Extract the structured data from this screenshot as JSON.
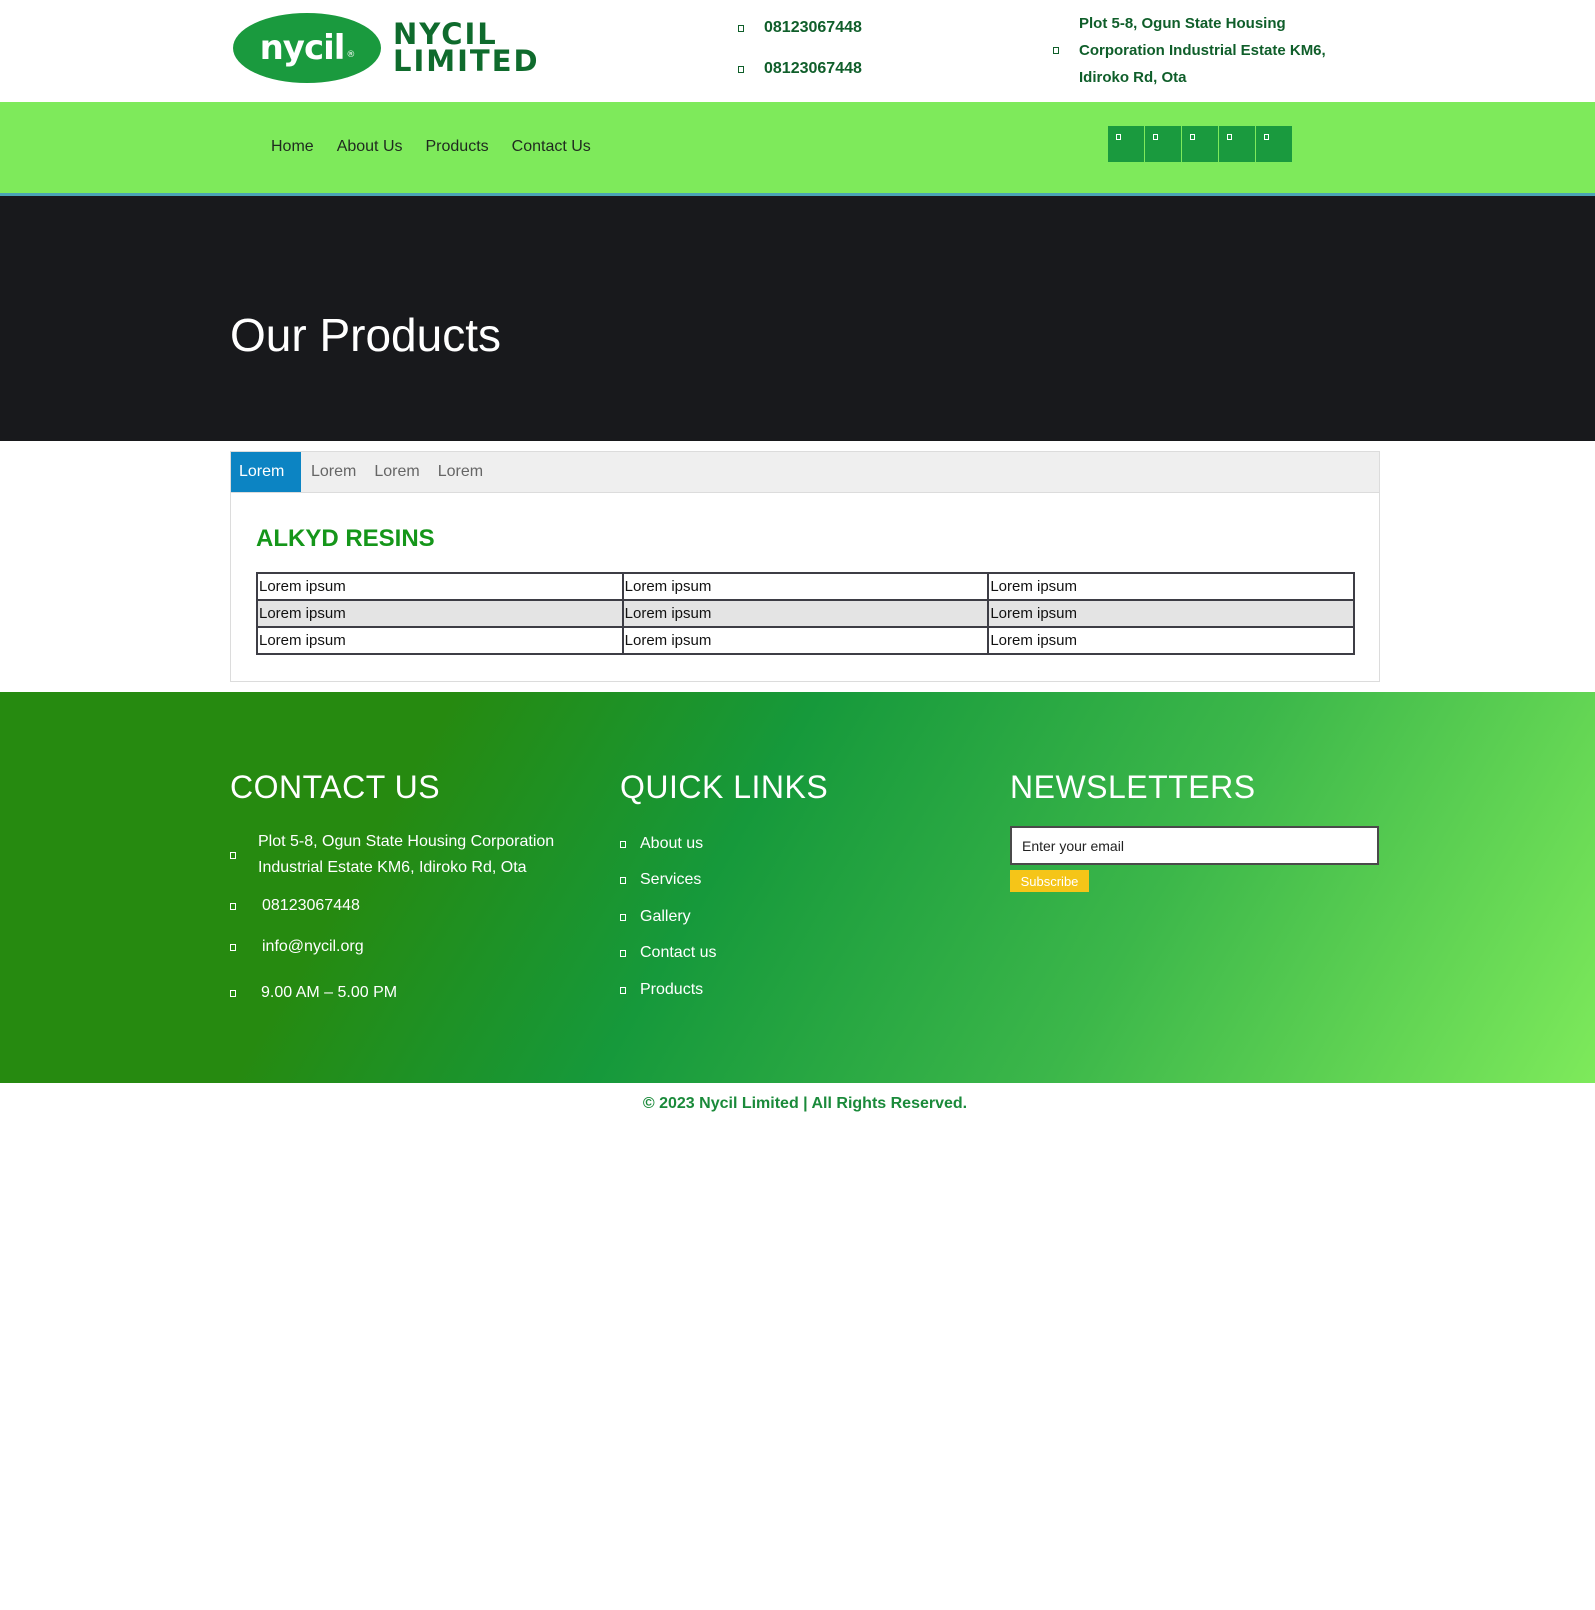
{
  "header": {
    "logo_mark": "nycil",
    "logo_reg": "®",
    "logo_name_line1": "NYCIL",
    "logo_name_line2": "LIMITED",
    "phone_1": "08123067448",
    "phone_2": "08123067448",
    "address": "Plot 5-8, Ogun State Housing Corporation Industrial Estate KM6, Idiroko Rd, Ota",
    "icon_phone": "phone-icon",
    "icon_address": "map-marker-icon"
  },
  "nav": {
    "items": [
      {
        "label": "Home"
      },
      {
        "label": "About Us"
      },
      {
        "label": "Products"
      },
      {
        "label": "Contact Us"
      }
    ],
    "social_icons": [
      "facebook-icon",
      "twitter-icon",
      "instagram-icon",
      "linkedin-icon",
      "youtube-icon"
    ]
  },
  "hero": {
    "title": "Our Products"
  },
  "product_tabs": {
    "tabs": [
      {
        "label": "Lorem",
        "active": true
      },
      {
        "label": "Lorem",
        "active": false
      },
      {
        "label": "Lorem",
        "active": false
      },
      {
        "label": "Lorem",
        "active": false
      }
    ],
    "section_title": "ALKYD RESINS",
    "table": {
      "rows": [
        [
          "Lorem ipsum",
          "Lorem ipsum",
          "Lorem ipsum"
        ],
        [
          "Lorem ipsum",
          "Lorem ipsum",
          "Lorem ipsum"
        ],
        [
          "Lorem ipsum",
          "Lorem ipsum",
          "Lorem ipsum"
        ]
      ]
    }
  },
  "footer": {
    "contact": {
      "heading": "CONTACT US",
      "address": "Plot 5-8, Ogun State Housing Corporation Industrial Estate KM6, Idiroko Rd, Ota",
      "phone": "08123067448",
      "email": "info@nycil.org",
      "hours": "9.00 AM – 5.00 PM"
    },
    "quick_links": {
      "heading": "QUICK LINKS",
      "items": [
        {
          "label": "About us"
        },
        {
          "label": "Services"
        },
        {
          "label": "Gallery"
        },
        {
          "label": "Contact us"
        },
        {
          "label": "Products"
        }
      ]
    },
    "newsletter": {
      "heading": "NEWSLETTERS",
      "email_placeholder": "Enter your email",
      "subscribe_label": "Subscribe"
    }
  },
  "copyright": "© 2023 Nycil Limited | All Rights Reserved.",
  "colors": {
    "brand_green": "#1a9a3e",
    "nav_green": "#7eea5b",
    "tab_active_blue": "#0c84c3",
    "heading_green": "#15961a",
    "subscribe_yellow": "#f5c518",
    "hero_dark": "#18191c"
  }
}
